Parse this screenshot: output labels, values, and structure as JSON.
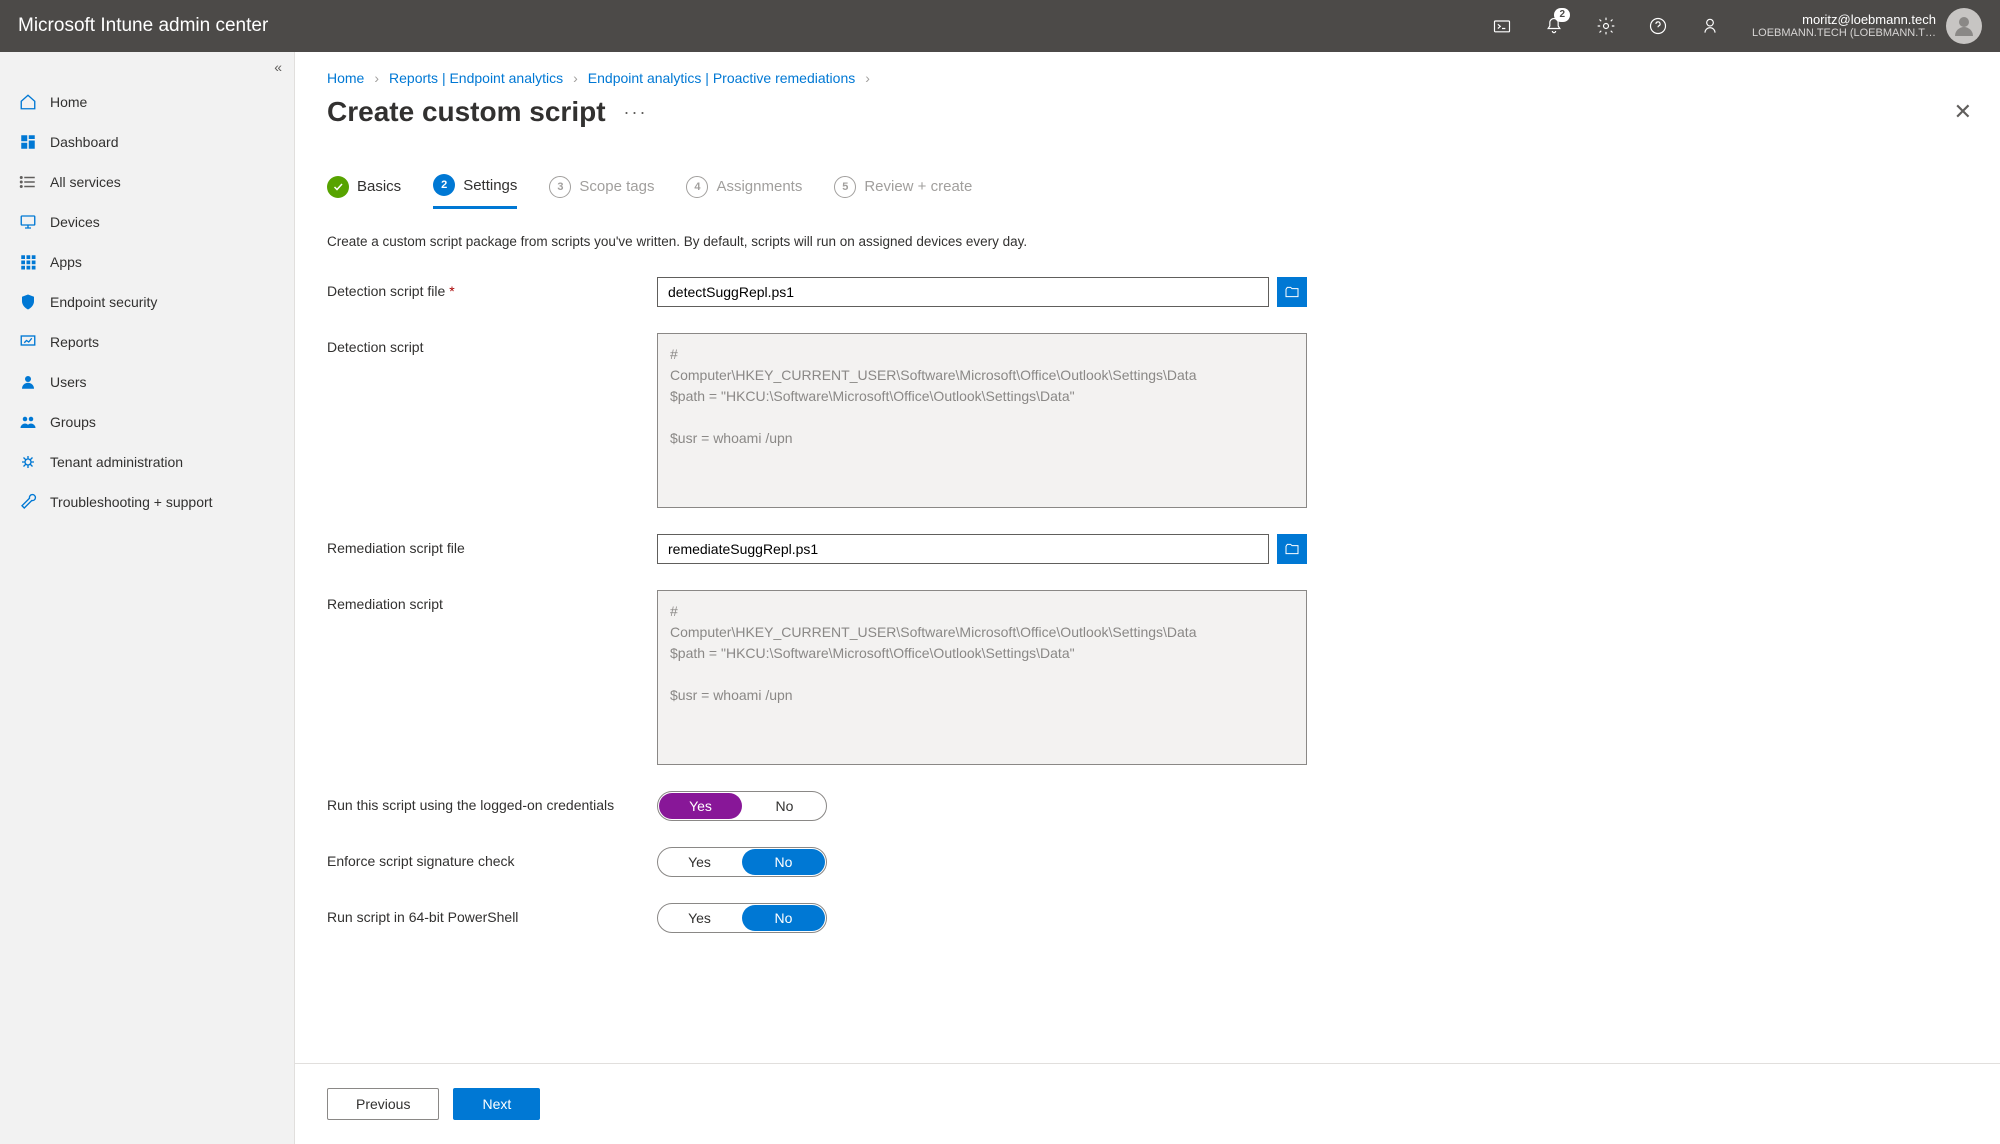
{
  "topbar": {
    "title": "Microsoft Intune admin center",
    "notification_count": "2",
    "account_email": "moritz@loebmann.tech",
    "account_org": "LOEBMANN.TECH (LOEBMANN.T…"
  },
  "sidebar": {
    "items": [
      {
        "label": "Home",
        "icon": "home"
      },
      {
        "label": "Dashboard",
        "icon": "dashboard"
      },
      {
        "label": "All services",
        "icon": "list"
      },
      {
        "label": "Devices",
        "icon": "device"
      },
      {
        "label": "Apps",
        "icon": "apps"
      },
      {
        "label": "Endpoint security",
        "icon": "shield"
      },
      {
        "label": "Reports",
        "icon": "reports"
      },
      {
        "label": "Users",
        "icon": "user"
      },
      {
        "label": "Groups",
        "icon": "groups"
      },
      {
        "label": "Tenant administration",
        "icon": "tenant"
      },
      {
        "label": "Troubleshooting + support",
        "icon": "wrench"
      }
    ]
  },
  "breadcrumb": {
    "items": [
      "Home",
      "Reports | Endpoint analytics",
      "Endpoint analytics | Proactive remediations"
    ]
  },
  "page": {
    "title": "Create custom script",
    "description": "Create a custom script package from scripts you've written. By default, scripts will run on assigned devices every day."
  },
  "steps": [
    {
      "num": "✓",
      "label": "Basics",
      "state": "done"
    },
    {
      "num": "2",
      "label": "Settings",
      "state": "current"
    },
    {
      "num": "3",
      "label": "Scope tags",
      "state": "later"
    },
    {
      "num": "4",
      "label": "Assignments",
      "state": "later"
    },
    {
      "num": "5",
      "label": "Review + create",
      "state": "later"
    }
  ],
  "form": {
    "detection_file_label": "Detection script file",
    "detection_file_value": "detectSuggRepl.ps1",
    "detection_script_label": "Detection script",
    "detection_script_value": "#\nComputer\\HKEY_CURRENT_USER\\Software\\Microsoft\\Office\\Outlook\\Settings\\Data\n$path = \"HKCU:\\Software\\Microsoft\\Office\\Outlook\\Settings\\Data\"\n\n$usr = whoami /upn",
    "remediation_file_label": "Remediation script file",
    "remediation_file_value": "remediateSuggRepl.ps1",
    "remediation_script_label": "Remediation script",
    "remediation_script_value": "#\nComputer\\HKEY_CURRENT_USER\\Software\\Microsoft\\Office\\Outlook\\Settings\\Data\n$path = \"HKCU:\\Software\\Microsoft\\Office\\Outlook\\Settings\\Data\"\n\n$usr = whoami /upn",
    "run_logged_on_label": "Run this script using the logged-on credentials",
    "enforce_sig_label": "Enforce script signature check",
    "run_64_label": "Run script in 64-bit PowerShell",
    "yes": "Yes",
    "no": "No"
  },
  "footer": {
    "previous": "Previous",
    "next": "Next"
  }
}
